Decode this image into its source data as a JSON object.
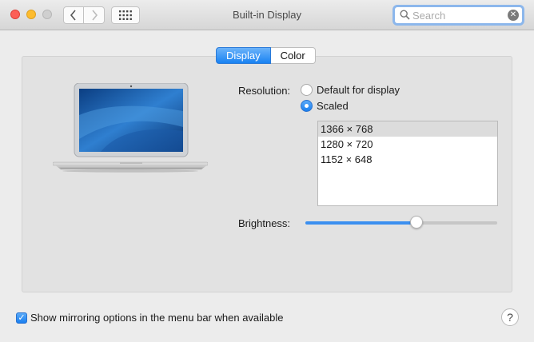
{
  "window": {
    "title": "Built-in Display"
  },
  "toolbar": {
    "search": {
      "placeholder": "Search",
      "value": ""
    }
  },
  "tabs": [
    {
      "label": "Display",
      "selected": true
    },
    {
      "label": "Color",
      "selected": false
    }
  ],
  "resolution": {
    "label": "Resolution:",
    "options": [
      {
        "label": "Default for display",
        "selected": false
      },
      {
        "label": "Scaled",
        "selected": true
      }
    ],
    "scaled_list": [
      "1366 × 768",
      "1280 × 720",
      "1152 × 648"
    ],
    "selected_index": 0
  },
  "brightness": {
    "label": "Brightness:",
    "value": 0.58
  },
  "mirroring": {
    "label": "Show mirroring options in the menu bar when available",
    "checked": true
  },
  "help": {
    "label": "?"
  },
  "colors": {
    "accent": "#1982f2",
    "close": "#fc5f57",
    "minimize": "#fdbc2e",
    "zoom": "#cfcfcf"
  }
}
